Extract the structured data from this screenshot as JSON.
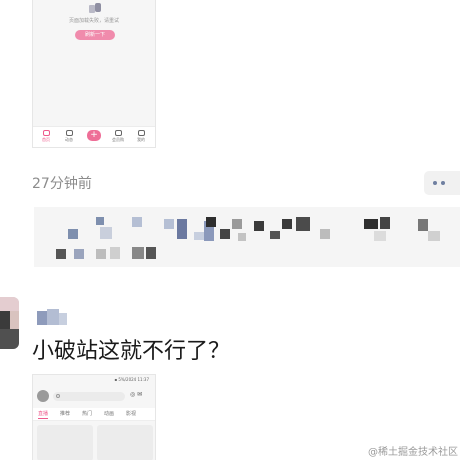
{
  "top_screenshot": {
    "empty_message": "页面加载失败，请重试",
    "refresh_button": "刷新一下",
    "nav": [
      {
        "label": "首页",
        "icon": "home-icon",
        "active": true
      },
      {
        "label": "动态",
        "icon": "dynamic-icon",
        "active": false
      },
      {
        "label": "+",
        "icon": "plus-icon",
        "active": false
      },
      {
        "label": "会员购",
        "icon": "shop-icon",
        "active": false
      },
      {
        "label": "我的",
        "icon": "profile-icon",
        "active": false
      }
    ]
  },
  "post": {
    "time": "27分钟前",
    "more_icon": "more-dots-icon"
  },
  "comment": {
    "text": "小破站这就不行了？"
  },
  "bottom_screenshot": {
    "status": "▪︎ 5%/2024 11:37",
    "tabs": [
      "直播",
      "推荐",
      "热门",
      "动画",
      "影视"
    ],
    "active_tab": "直播"
  },
  "watermark": "@稀土掘金技术社区",
  "colors": {
    "accent_pink": "#ee6e97",
    "time_gray": "#8c8c8c",
    "panel_bg": "#f5f5f5"
  }
}
